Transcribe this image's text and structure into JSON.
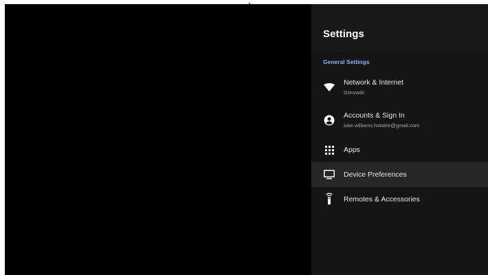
{
  "settings": {
    "title": "Settings",
    "section_label": "General Settings",
    "items": [
      {
        "label": "Network & Internet",
        "subtitle": "Gonzado",
        "icon": "wifi-icon"
      },
      {
        "label": "Accounts & Sign In",
        "subtitle": "luke.williams.hotwire@gmail.com",
        "icon": "account-circle-icon"
      },
      {
        "label": "Apps",
        "icon": "apps-grid-icon"
      },
      {
        "label": "Device Preferences",
        "icon": "tv-icon",
        "selected": true
      },
      {
        "label": "Remotes & Accessories",
        "icon": "remote-icon"
      }
    ]
  },
  "colors": {
    "background": "#000000",
    "panel": "#141414",
    "selected": "#262626",
    "accent": "#8ab4f8"
  }
}
